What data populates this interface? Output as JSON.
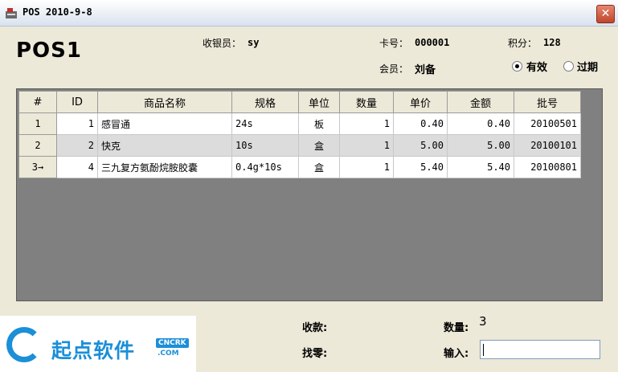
{
  "window": {
    "title": "POS 2010-9-8",
    "close_glyph": "✕"
  },
  "header": {
    "pos_name": "POS1",
    "cashier_label": "收银员：",
    "cashier_value": "sy",
    "card_label": "卡号：",
    "card_value": "000001",
    "points_label": "积分：",
    "points_value": "128",
    "member_label": "会员：",
    "member_value": "刘备",
    "status_valid": "有效",
    "status_expired": "过期",
    "status_selected": "有效"
  },
  "grid": {
    "columns": [
      "#",
      "ID",
      "商品名称",
      "规格",
      "单位",
      "数量",
      "单价",
      "金额",
      "批号"
    ],
    "rows": [
      {
        "no": "1",
        "id": "1",
        "name": "感冒通",
        "spec": "24s",
        "unit": "板",
        "qty": "1",
        "price": "0.40",
        "amount": "0.40",
        "batch": "20100501"
      },
      {
        "no": "2",
        "id": "2",
        "name": "快克",
        "spec": "10s",
        "unit": "盒",
        "qty": "1",
        "price": "5.00",
        "amount": "5.00",
        "batch": "20100101"
      },
      {
        "no": "3→",
        "id": "4",
        "name": "三九复方氨酚烷胺胶囊",
        "spec": "0.4g*10s",
        "unit": "盒",
        "qty": "1",
        "price": "5.40",
        "amount": "5.40",
        "batch": "20100801"
      }
    ]
  },
  "footer": {
    "received_label": "收款:",
    "change_label": "找零:",
    "quantity_label": "数量:",
    "quantity_value": "3",
    "input_label": "输入:",
    "input_value": ""
  },
  "watermark": {
    "brand_text": "起点软件",
    "badge": "CNCRK",
    "sub": ".COM"
  }
}
